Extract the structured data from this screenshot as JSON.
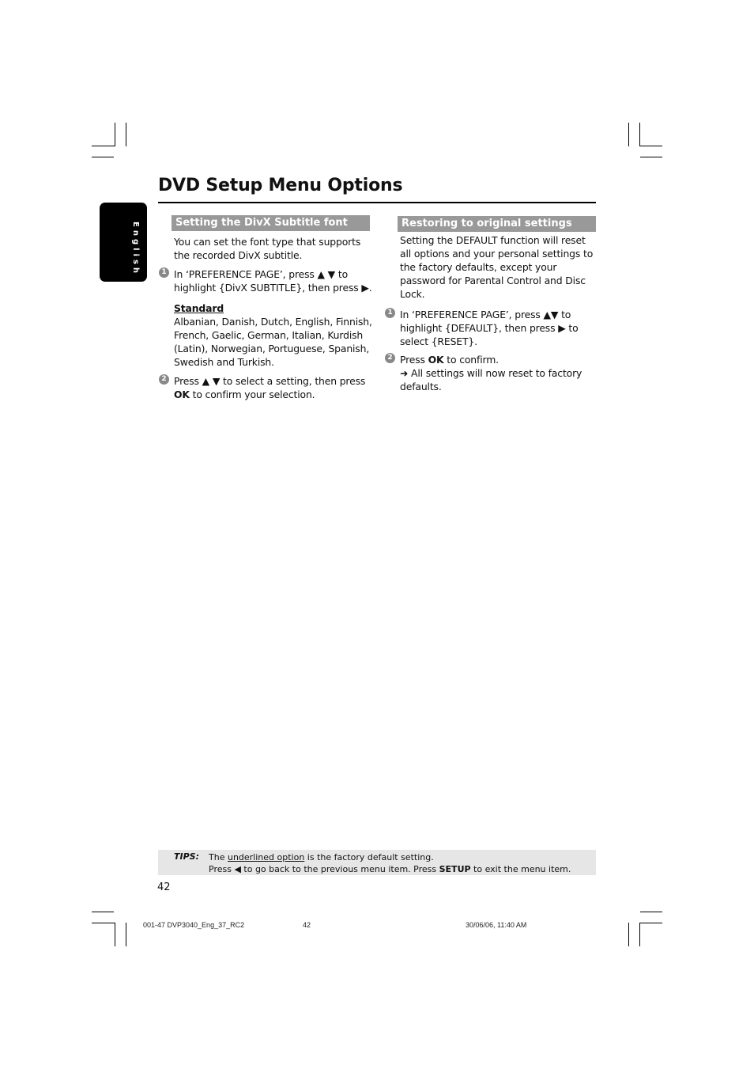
{
  "page": {
    "title": "DVD Setup Menu Options",
    "language_tab": "English",
    "page_number": "42"
  },
  "left_section": {
    "heading": "Setting the DivX Subtitle font",
    "intro_1": "You can set the font type that supports",
    "intro_2": "the recorded DivX subtitle.",
    "step1_marker": "1",
    "step1_line1": "In ‘PREFERENCE PAGE’, press ▲ ▼ to",
    "step1_line2": "highlight {DivX SUBTITLE}, then press ▶.",
    "option_title": "Standard",
    "option_lines": [
      "Albanian, Danish, Dutch, English, Finnish,",
      "French, Gaelic, German, Italian, Kurdish",
      "(Latin), Norwegian, Portuguese, Spanish,",
      "Swedish and Turkish."
    ],
    "step2_marker": "2",
    "step2_line1": "Press ▲ ▼ to select a setting, then press",
    "step2_ok": "OK",
    "step2_line2_rest": " to confirm your selection."
  },
  "right_section": {
    "heading": "Restoring to original settings",
    "intro_lines": [
      "Setting the DEFAULT function will reset",
      "all options and your personal settings to",
      "the factory defaults, except your",
      "password for Parental Control and Disc",
      "Lock."
    ],
    "step1_marker": "1",
    "step1_lines": [
      "In ‘PREFERENCE PAGE’, press ▲▼ to",
      "highlight {DEFAULT}, then press ▶  to",
      "select {RESET}."
    ],
    "step2_marker": "2",
    "step2_press": "Press ",
    "step2_ok": "OK",
    "step2_rest": " to confirm.",
    "result_line1": "➜ All settings will now reset to factory",
    "result_line2": "defaults."
  },
  "tips": {
    "label": "TIPS:",
    "line1_pre": "The ",
    "line1_underlined": "underlined option",
    "line1_post": " is the factory default setting.",
    "line2_pre": "Press ◀ to go back to the previous menu item. Press ",
    "line2_bold": "SETUP",
    "line2_post": " to exit the menu item."
  },
  "footer": {
    "file": "001-47 DVP3040_Eng_37_RC2",
    "page": "42",
    "datetime": "30/06/06, 11:40 AM"
  }
}
